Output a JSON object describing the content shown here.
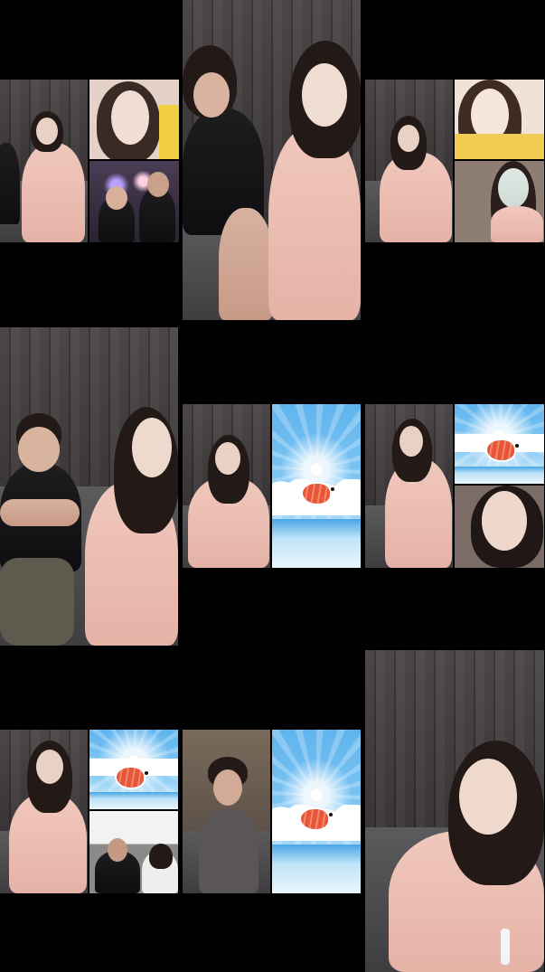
{
  "screen": {
    "description_tiles": [
      {
        "id": "tile-1",
        "layout": "main-plus-two-guests"
      },
      {
        "id": "tile-2",
        "layout": "single"
      },
      {
        "id": "tile-3",
        "layout": "main-plus-two-guests"
      },
      {
        "id": "tile-4",
        "layout": "single"
      },
      {
        "id": "tile-5",
        "layout": "main-plus-one-guest"
      },
      {
        "id": "tile-6",
        "layout": "main-plus-two-guests"
      },
      {
        "id": "tile-7",
        "layout": "main-plus-two-guests"
      },
      {
        "id": "tile-8",
        "layout": "main-plus-one-guest"
      },
      {
        "id": "tile-9",
        "layout": "single"
      }
    ]
  },
  "colors": {
    "background": "#000000",
    "hoodie": "#f1c8bd",
    "sky": "#5fb4ee",
    "shrimp": "#e8563a"
  }
}
